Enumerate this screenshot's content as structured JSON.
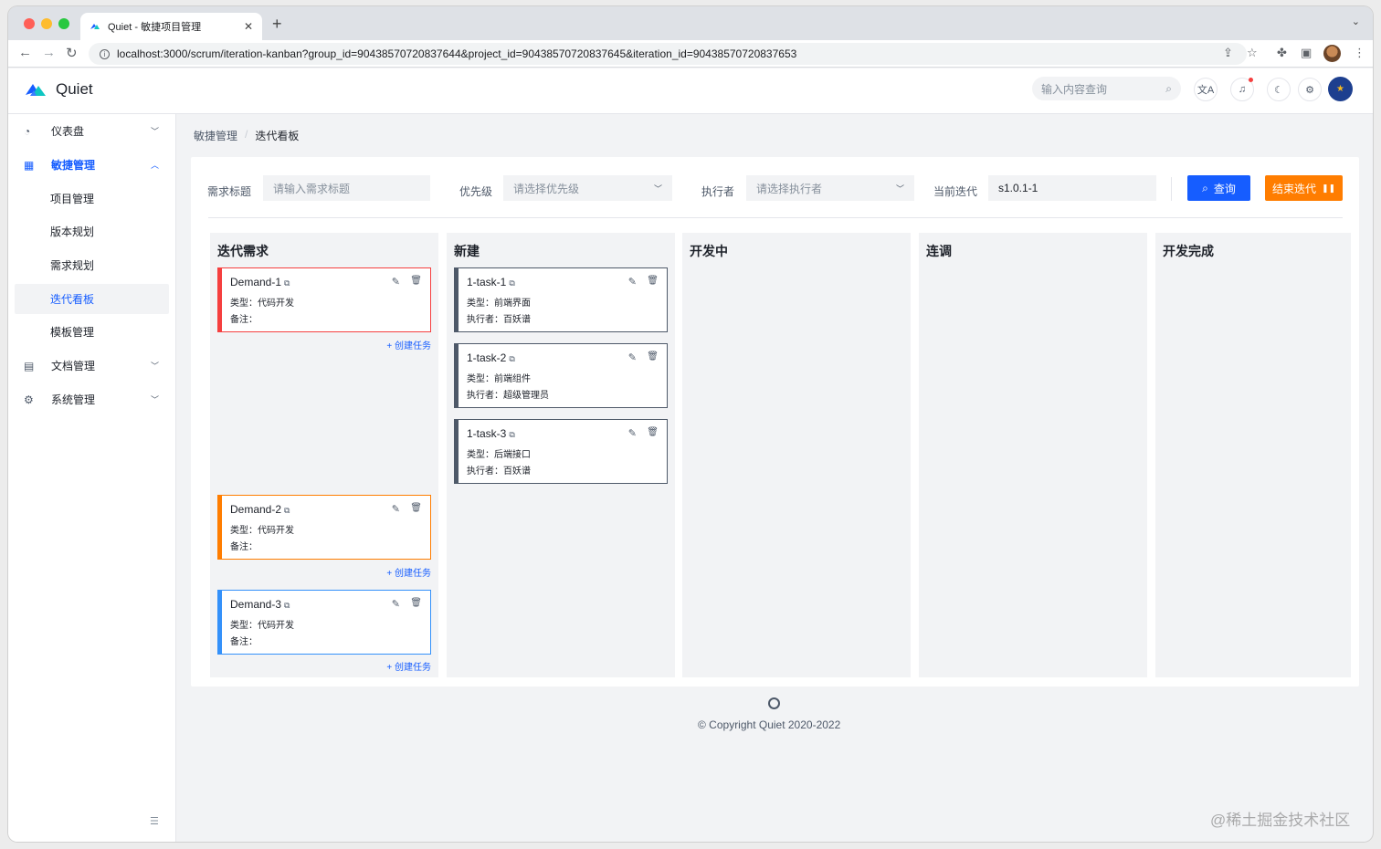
{
  "browser": {
    "tab_title": "Quiet - 敏捷项目管理",
    "tab_close": "✕",
    "new_tab": "+",
    "url": "localhost:3000/scrum/iteration-kanban?group_id=90438570720837644&project_id=90438570720837645&iteration_id=90438570720837653"
  },
  "header": {
    "brand": "Quiet",
    "search_placeholder": "输入内容查询",
    "icons": [
      "translate-icon",
      "bell-icon",
      "moon-icon",
      "gear-icon"
    ]
  },
  "sidebar": {
    "items": [
      {
        "label": "仪表盘",
        "icon": "dashboard-icon",
        "expandable": true
      },
      {
        "label": "敏捷管理",
        "icon": "grid-icon",
        "expandable": true,
        "open": true
      },
      {
        "label": "项目管理",
        "sub": true
      },
      {
        "label": "版本规划",
        "sub": true
      },
      {
        "label": "需求规划",
        "sub": true
      },
      {
        "label": "迭代看板",
        "sub": true,
        "active": true
      },
      {
        "label": "模板管理",
        "sub": true
      },
      {
        "label": "文档管理",
        "icon": "document-icon",
        "expandable": true
      },
      {
        "label": "系统管理",
        "icon": "gear-icon",
        "expandable": true
      }
    ]
  },
  "breadcrumb": [
    "敏捷管理",
    "迭代看板"
  ],
  "filters": {
    "title_label": "需求标题",
    "title_placeholder": "请输入需求标题",
    "priority_label": "优先级",
    "priority_placeholder": "请选择优先级",
    "executor_label": "执行者",
    "executor_placeholder": "请选择执行者",
    "iteration_label": "当前迭代",
    "iteration_value": "s1.0.1-1",
    "search_button": "查询",
    "end_button": "结束迭代"
  },
  "board": {
    "columns": [
      {
        "title": "迭代需求"
      },
      {
        "title": "新建"
      },
      {
        "title": "开发中"
      },
      {
        "title": "连调"
      },
      {
        "title": "开发完成"
      }
    ],
    "demands": [
      {
        "title": "Demand-1",
        "type_line": "类型：代码开发",
        "remark_line": "备注：",
        "color": "#f53f3f"
      },
      {
        "title": "Demand-2",
        "type_line": "类型：代码开发",
        "remark_line": "备注：",
        "color": "#ff7d00"
      },
      {
        "title": "Demand-3",
        "type_line": "类型：代码开发",
        "remark_line": "备注：",
        "color": "#3491fa"
      }
    ],
    "create_task": "+ 创建任务",
    "tasks": [
      {
        "title": "1-task-1",
        "type_line": "类型：前端界面",
        "executor_line": "执行者：百妖谱"
      },
      {
        "title": "1-task-2",
        "type_line": "类型：前端组件",
        "executor_line": "执行者：超级管理员"
      },
      {
        "title": "1-task-3",
        "type_line": "类型：后端接口",
        "executor_line": "执行者：百妖谱"
      }
    ],
    "task_color": "#4e5969"
  },
  "footer": {
    "copyright": "© Copyright Quiet 2020-2022"
  },
  "watermark": "@稀土掘金技术社区",
  "colors": {
    "primary": "#165dff",
    "warning": "#ff7d00"
  }
}
